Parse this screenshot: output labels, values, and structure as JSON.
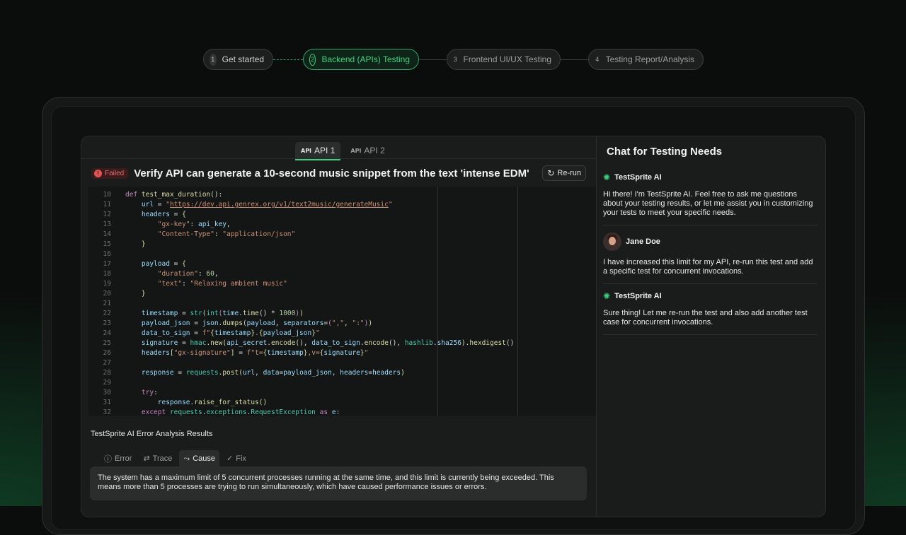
{
  "stepper": {
    "steps": [
      {
        "num": "1",
        "label": "Get started"
      },
      {
        "num": "2",
        "label": "Backend (APIs) Testing"
      },
      {
        "num": "3",
        "label": "Frontend UI/UX Testing"
      },
      {
        "num": "4",
        "label": "Testing Report/Analysis"
      }
    ]
  },
  "tabs": [
    {
      "icon": "API",
      "label": "API 1"
    },
    {
      "icon": "API",
      "label": "API 2"
    }
  ],
  "test": {
    "status": "Failed",
    "title": "Verify API can generate a 10-second music snippet from the text 'intense EDM'",
    "rerun_label": "Re-run"
  },
  "code": {
    "line_numbers": [
      "10",
      "11",
      "12",
      "13",
      "14",
      "15",
      "16",
      "17",
      "18",
      "19",
      "20",
      "21",
      "22",
      "23",
      "24",
      "25",
      "26",
      "27",
      "28",
      "29",
      "30",
      "31",
      "32"
    ]
  },
  "analysis": {
    "title": "TestSprite AI Error Analysis Results",
    "tabs": [
      "Error",
      "Trace",
      "Cause",
      "Fix"
    ],
    "text": "The system has a maximum limit of 5 concurrent processes running at the same time, and this limit is currently being exceeded. This means more than 5 processes are trying to run simultaneously, which have caused performance issues or errors."
  },
  "chat": {
    "title": "Chat for Testing Needs",
    "messages": [
      {
        "author": "TestSprite AI",
        "text": "Hi there! I'm TestSprite AI. Feel free to ask me questions about your testing results, or let me assist you in customizing your tests to meet your specific needs."
      },
      {
        "author": "Jane Doe",
        "text": "I have increased this limit for my API, re-run this test and add a specific test for concurrent invocations."
      },
      {
        "author": "TestSprite AI",
        "text": "Sure thing! Let me re-run the test and also add another test case for concurrent invocations."
      }
    ]
  },
  "colors": {
    "accent": "#3fd07f",
    "failed": "#e25555",
    "background": "#0b0d0c"
  }
}
